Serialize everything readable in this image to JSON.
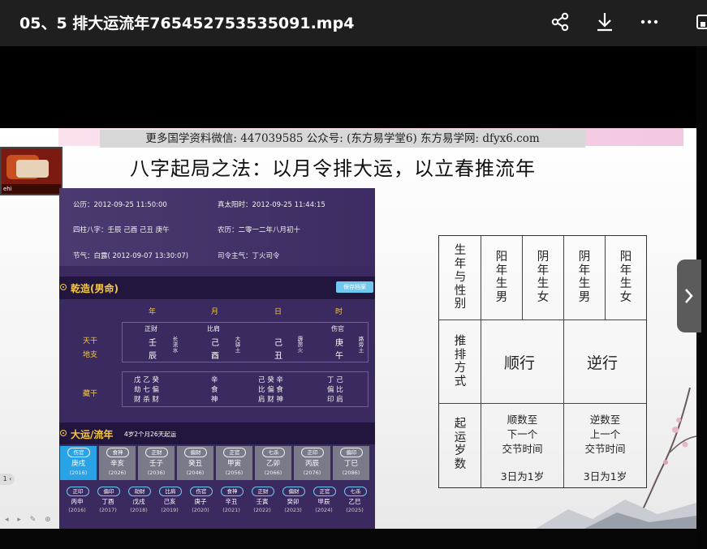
{
  "window": {
    "title": "05、5 排大运流年765452753535091.mp4",
    "icons": [
      "share-icon",
      "download-icon",
      "more-icon",
      "pip-icon"
    ]
  },
  "slide": {
    "promo": "更多国学资料微信: 447039585 公众号: (东方易学堂6) 东方易学网: dfyx6.com",
    "heading": "八字起局之法：以月令排大运，以立春推流年",
    "thumbnail_label": "ehi"
  },
  "panel": {
    "gongli": "公历：2012-09-25 11:50:00",
    "taiyang": "真太阳时：2012-09-25 11:44:15",
    "sizhu": "四柱八字：壬辰  己酉  己丑  庚午",
    "nongli": "农历：二零一二年八月初十",
    "jieqi": "节气：白露( 2012-09-07 13:30:07)",
    "siling": "司令主气：丁火司令",
    "qianzao": "乾造(男命)",
    "save": "保存档案",
    "columns": [
      "年",
      "月",
      "日",
      "时"
    ],
    "tiangan_label": "天干",
    "dizhi_label": "地支",
    "canggan_label": "藏干",
    "pillars": [
      {
        "shishen": "正财",
        "gan": "壬",
        "zhi": "辰",
        "nayin": "长流水"
      },
      {
        "shishen": "比肩",
        "gan": "己",
        "zhi": "酉",
        "nayin": "大驿土"
      },
      {
        "shishen": "",
        "gan": "己",
        "zhi": "丑",
        "nayin": "霹雳火"
      },
      {
        "shishen": "伤官",
        "gan": "庚",
        "zhi": "午",
        "nayin": "路旁土"
      }
    ],
    "canggan": [
      {
        "gan": "戊 乙 癸",
        "god": "劫 七 偏",
        "god2": "财 杀 财"
      },
      {
        "gan": "辛",
        "god": "食",
        "god2": "神"
      },
      {
        "gan": "己 癸 辛",
        "god": "比 偏 食",
        "god2": "肩 财 神"
      },
      {
        "gan": "丁 己",
        "god": "偏 比",
        "god2": "印 肩"
      }
    ],
    "dayun_title": "大运/流年",
    "qiyun": "4岁2个月26天起运",
    "dayun": [
      {
        "god": "伤官",
        "gz": "庚戌",
        "year": "(2016)"
      },
      {
        "god": "食神",
        "gz": "辛亥",
        "year": "(2026)"
      },
      {
        "god": "正财",
        "gz": "壬子",
        "year": "(2036)"
      },
      {
        "god": "偏财",
        "gz": "癸丑",
        "year": "(2046)"
      },
      {
        "god": "正官",
        "gz": "甲寅",
        "year": "(2056)"
      },
      {
        "god": "七杀",
        "gz": "乙卯",
        "year": "(2066)"
      },
      {
        "god": "正印",
        "gz": "丙辰",
        "year": "(2076)"
      },
      {
        "god": "偏印",
        "gz": "丁巳",
        "year": "(2086)"
      }
    ],
    "liunian": [
      {
        "god": "正印",
        "gz": "丙申",
        "year": "(2016)"
      },
      {
        "god": "偏印",
        "gz": "丁酉",
        "year": "(2017)"
      },
      {
        "god": "劫财",
        "gz": "戊戌",
        "year": "(2018)"
      },
      {
        "god": "比肩",
        "gz": "己亥",
        "year": "(2019)"
      },
      {
        "god": "伤官",
        "gz": "庚子",
        "year": "(2020)"
      },
      {
        "god": "食神",
        "gz": "辛丑",
        "year": "(2021)"
      },
      {
        "god": "正财",
        "gz": "壬寅",
        "year": "(2022)"
      },
      {
        "god": "偏财",
        "gz": "癸卯",
        "year": "(2023)"
      },
      {
        "god": "正官",
        "gz": "甲辰",
        "year": "(2024)"
      },
      {
        "god": "七杀",
        "gz": "乙巳",
        "year": "(2025)"
      }
    ]
  },
  "rule_table": {
    "row1_label": "生年与性别",
    "headers": [
      "阳年生男",
      "阴年生女",
      "阴年生男",
      "阳年生女"
    ],
    "row2_label": "推排方式",
    "forward": "顺行",
    "backward": "逆行",
    "row3_label": "起运岁数",
    "forward_desc": [
      "顺数至",
      "下一个",
      "交节时间"
    ],
    "backward_desc": [
      "逆数至",
      "上一个",
      "交节时间"
    ],
    "forward_rule": "3日为1岁",
    "backward_rule": "3日为1岁"
  },
  "player": {
    "speed": "1 ‹",
    "next_label": "›"
  }
}
